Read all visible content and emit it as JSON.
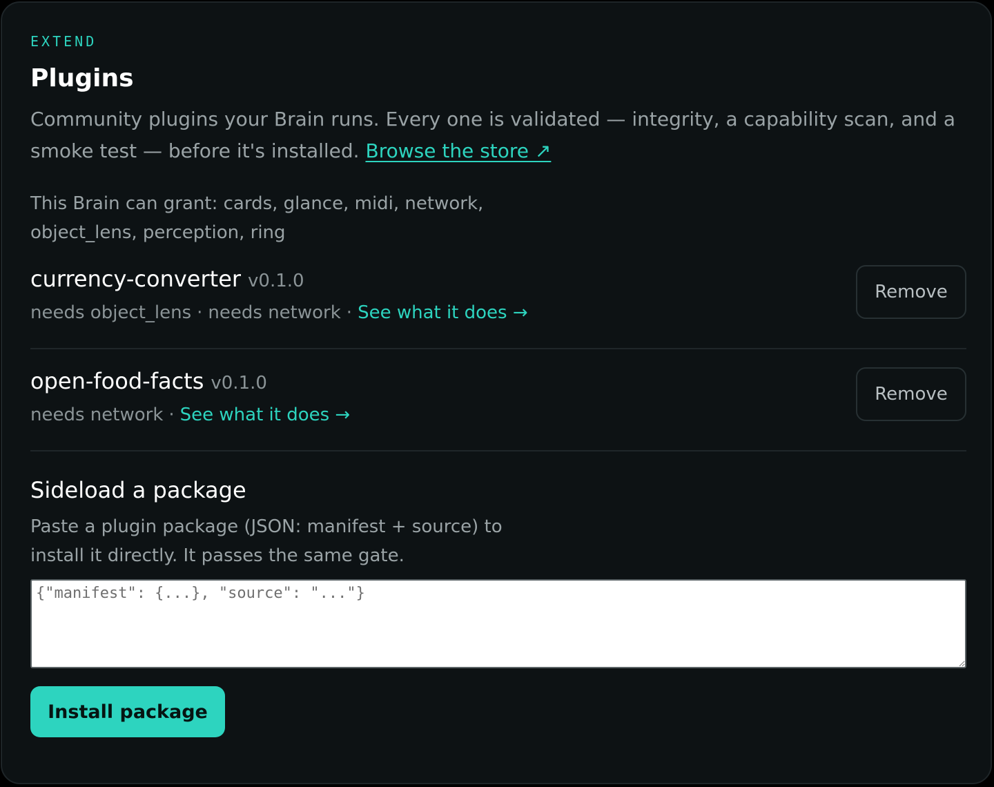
{
  "header": {
    "eyebrow": "EXTEND",
    "title": "Plugins",
    "intro": "Community plugins your Brain runs. Every one is validated — integrity, a capability scan, and a smoke test — before it's installed.",
    "store_link": "Browse the store ↗"
  },
  "grants": {
    "text": "This Brain can grant: cards, glance, midi, network, object_lens, perception, ring"
  },
  "plugins": [
    {
      "name": "currency-converter",
      "version": "v0.1.0",
      "needs": [
        "needs object_lens",
        "needs network"
      ],
      "separator": "·",
      "details_link": "See what it does →",
      "remove_label": "Remove"
    },
    {
      "name": "open-food-facts",
      "version": "v0.1.0",
      "needs": [
        "needs network"
      ],
      "separator": "·",
      "details_link": "See what it does →",
      "remove_label": "Remove"
    }
  ],
  "sideload": {
    "title": "Sideload a package",
    "description": "Paste a plugin package (JSON: manifest + source) to install it directly. It passes the same gate.",
    "placeholder": "{\"manifest\": {...}, \"source\": \"...\"}",
    "value": "",
    "install_label": "Install package"
  },
  "colors": {
    "accent": "#2dd4bf",
    "panel_bg": "#0d1214",
    "text_primary": "#ffffff",
    "text_muted": "#9aa3a6"
  }
}
